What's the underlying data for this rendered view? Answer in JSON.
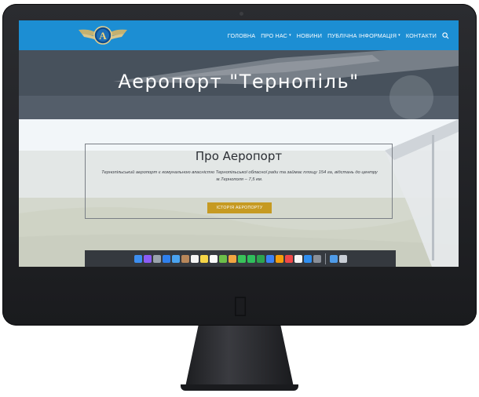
{
  "site": {
    "logo_icon": "airport-wings-logo-icon"
  },
  "nav": {
    "items": [
      {
        "label": "ГОЛОВНА",
        "dropdown": false
      },
      {
        "label": "ПРО НАС",
        "dropdown": true
      },
      {
        "label": "НОВИНИ",
        "dropdown": false
      },
      {
        "label": "ПУБЛІЧНА ІНФОРМАЦІЯ",
        "dropdown": true
      },
      {
        "label": "КОНТАКТИ",
        "dropdown": false
      }
    ],
    "search_icon": "search-icon",
    "caret": "▾"
  },
  "hero": {
    "title": "Аеропорт \"Тернопіль\""
  },
  "about": {
    "title": "Про Аеропорт",
    "text": "Тернопільський аеропорт є комунальною власністю Тернопільської обласної ради та займає площу 154 га, відстань до центру м.Тернополя – 7,5 км.",
    "button_label": "ІСТОРІЯ АЕРОПОРТУ"
  },
  "dock": {
    "icons": [
      {
        "name": "finder-icon",
        "color": "#3d8ef0"
      },
      {
        "name": "siri-icon",
        "color": "#8b5cf6"
      },
      {
        "name": "launchpad-icon",
        "color": "#9aa3ad"
      },
      {
        "name": "safari-icon",
        "color": "#2f80ed"
      },
      {
        "name": "mail-icon",
        "color": "#4aa3f0"
      },
      {
        "name": "contacts-icon",
        "color": "#b8875a"
      },
      {
        "name": "calendar-icon",
        "color": "#f4f4f4"
      },
      {
        "name": "notes-icon",
        "color": "#f5d547"
      },
      {
        "name": "reminders-icon",
        "color": "#fafafa"
      },
      {
        "name": "maps-icon",
        "color": "#6cc04a"
      },
      {
        "name": "photos-icon",
        "color": "#f2a541"
      },
      {
        "name": "messages-icon",
        "color": "#39c35a"
      },
      {
        "name": "facetime-icon",
        "color": "#2fbf5c"
      },
      {
        "name": "numbers-icon",
        "color": "#2da44e"
      },
      {
        "name": "keynote-icon",
        "color": "#3b82f6"
      },
      {
        "name": "pages-icon",
        "color": "#f59e0b"
      },
      {
        "name": "news-icon",
        "color": "#f04848"
      },
      {
        "name": "music-icon",
        "color": "#f5f5f5"
      },
      {
        "name": "app-store-icon",
        "color": "#2f8ef0"
      },
      {
        "name": "system-preferences-icon",
        "color": "#8a8f98"
      }
    ],
    "trailing": [
      {
        "name": "downloads-folder-icon",
        "color": "#4f9be8"
      },
      {
        "name": "trash-icon",
        "color": "#c9ced6"
      }
    ]
  }
}
